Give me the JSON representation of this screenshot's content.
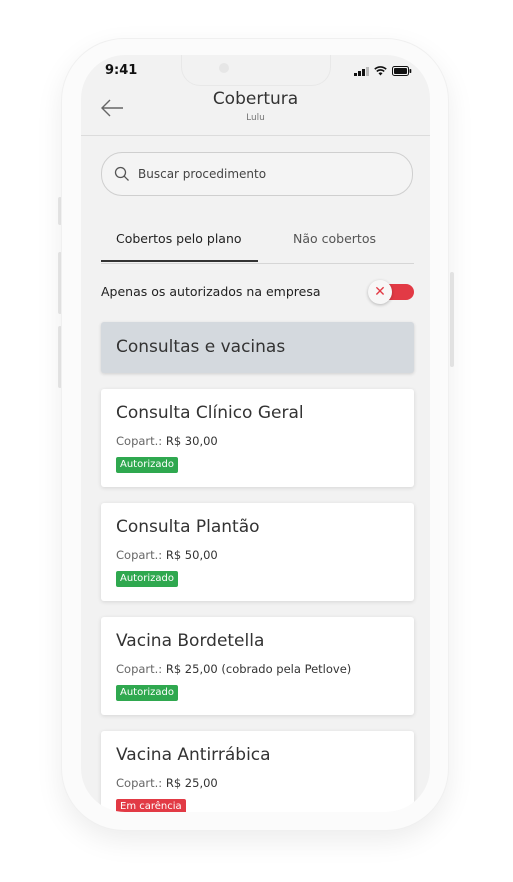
{
  "status_bar": {
    "time": "9:41"
  },
  "header": {
    "title": "Cobertura",
    "subtitle": "Lulu"
  },
  "search": {
    "placeholder": "Buscar procedimento"
  },
  "tabs": [
    {
      "label": "Cobertos pelo plano",
      "active": true
    },
    {
      "label": "Não cobertos",
      "active": false
    }
  ],
  "filter": {
    "label": "Apenas os autorizados na empresa",
    "toggle_on": true
  },
  "section": {
    "title": "Consultas e vacinas"
  },
  "copart_label": "Copart.:",
  "colors": {
    "accent_red": "#e23a45",
    "authorized_green": "#2fa84f",
    "waiting_red": "#e23a45",
    "section_bg": "#d4d9de"
  },
  "procedures": [
    {
      "name": "Consulta Clínico Geral",
      "copart_value": "R$ 30,00",
      "status": "Autorizado",
      "status_type": "authorized"
    },
    {
      "name": "Consulta Plantão",
      "copart_value": "R$ 50,00",
      "status": "Autorizado",
      "status_type": "authorized"
    },
    {
      "name": "Vacina Bordetella",
      "copart_value": "R$ 25,00 (cobrado pela Petlove)",
      "status": "Autorizado",
      "status_type": "authorized"
    },
    {
      "name": "Vacina Antirrábica",
      "copart_value": "R$ 25,00",
      "status": "Em carência",
      "status_type": "waiting"
    }
  ]
}
